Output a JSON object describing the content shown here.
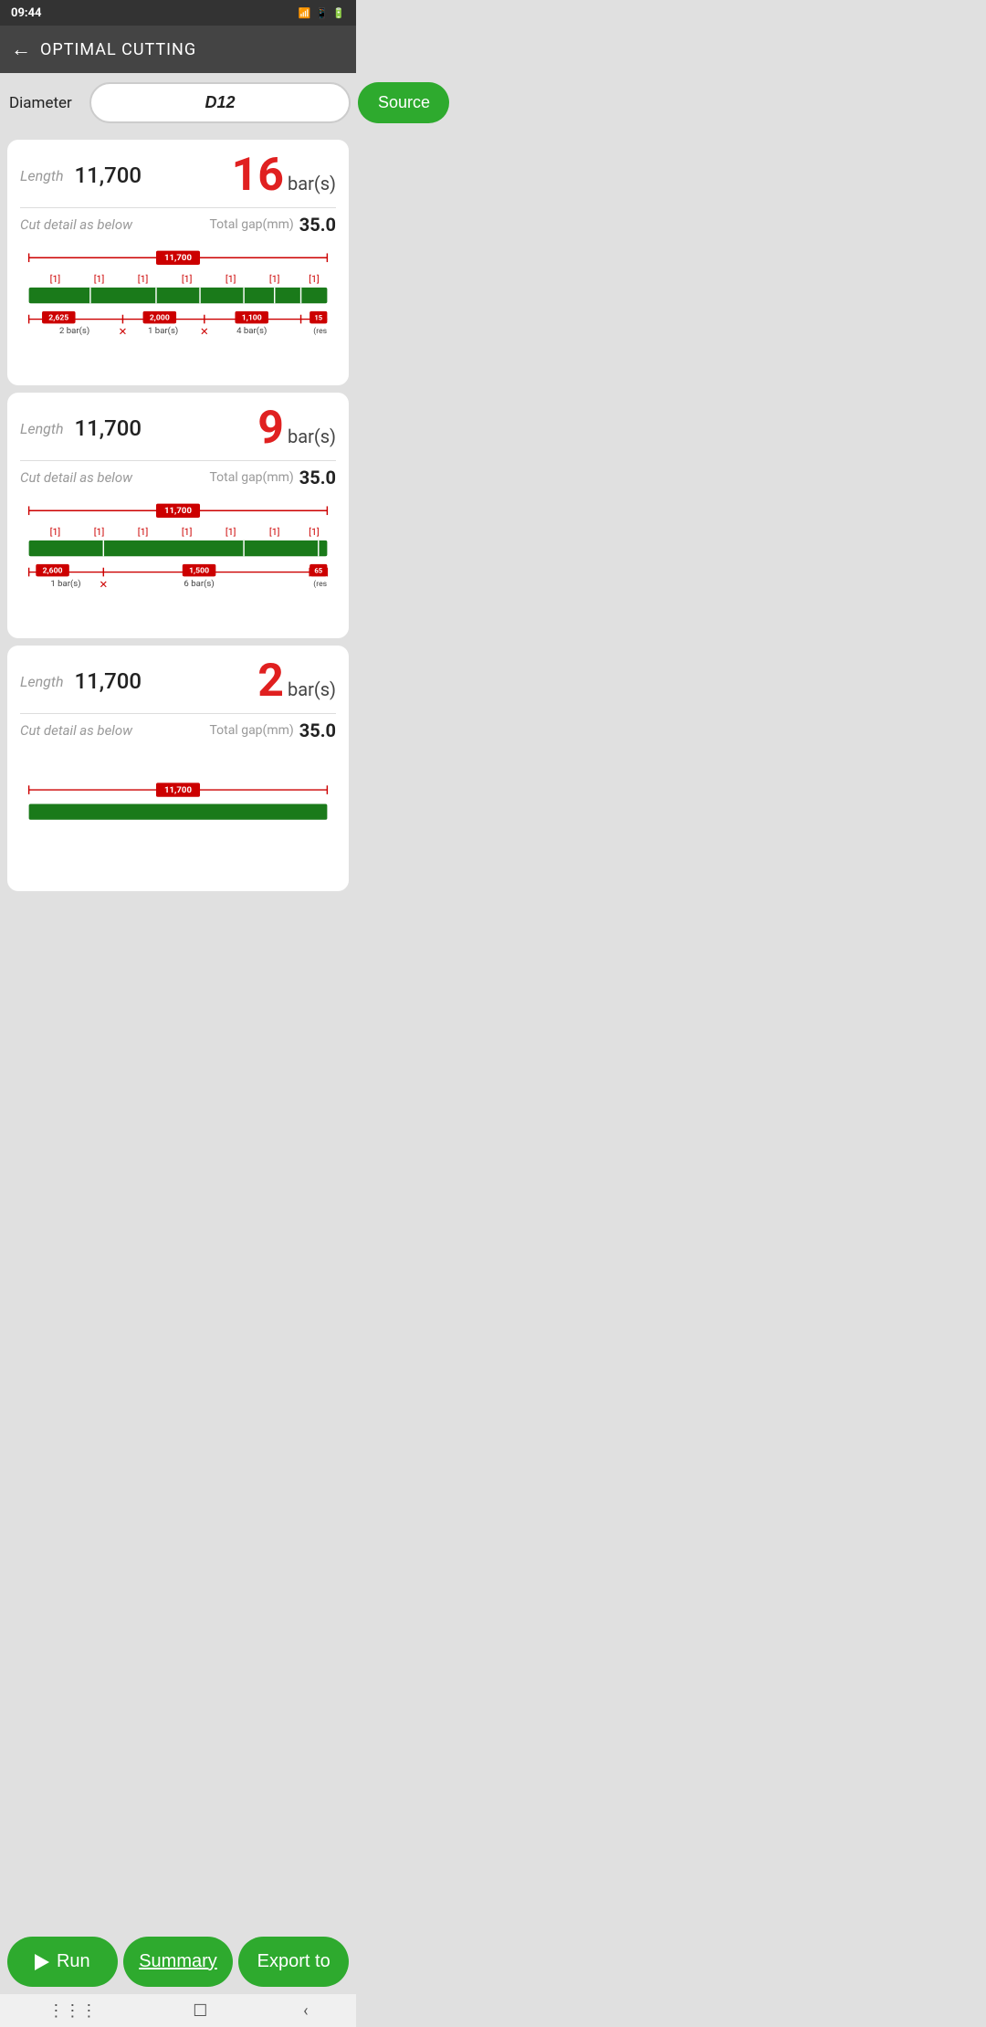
{
  "status": {
    "time": "09:44",
    "wifi": "WiFi",
    "signal": "Signal",
    "battery": "Battery"
  },
  "header": {
    "title": "OPTIMAL CUTTING",
    "back_label": "←"
  },
  "diameter": {
    "label": "Diameter",
    "value": "D12",
    "source_btn": "Source"
  },
  "results": [
    {
      "length_label": "Length",
      "length_value": "11,700",
      "bars_count": "16",
      "bars_unit": "bar(s)",
      "cut_detail_label": "Cut detail as below",
      "gap_label": "Total gap(mm)",
      "gap_value": "35.0",
      "diagram_total": "11,700",
      "segments": [
        {
          "label": "2,625",
          "count": "2 bar(s)"
        },
        {
          "label": "2,000",
          "count": "1 bar(s)"
        },
        {
          "label": "1,100",
          "count": "4 bar(s)"
        },
        {
          "label": "15",
          "count": "(res"
        }
      ],
      "bracket_labels": [
        "[1]",
        "[1]",
        "[1]",
        "[1]",
        "[1]",
        "[1]",
        "[1]"
      ]
    },
    {
      "length_label": "Length",
      "length_value": "11,700",
      "bars_count": "9",
      "bars_unit": "bar(s)",
      "cut_detail_label": "Cut detail as below",
      "gap_label": "Total gap(mm)",
      "gap_value": "35.0",
      "diagram_total": "11,700",
      "segments": [
        {
          "label": "2,600",
          "count": "1 bar(s)"
        },
        {
          "label": "1,500",
          "count": "6 bar(s)"
        },
        {
          "label": "65",
          "count": "(res"
        }
      ],
      "bracket_labels": [
        "[1]",
        "[1]",
        "[1]",
        "[1]",
        "[1]",
        "[1]",
        "[1]"
      ]
    },
    {
      "length_label": "Length",
      "length_value": "11,700",
      "bars_count": "2",
      "bars_unit": "bar(s)",
      "cut_detail_label": "Cut detail as below",
      "gap_label": "Total gap(mm)",
      "gap_value": "35.0",
      "diagram_total": "11,700",
      "segments": [],
      "bracket_labels": []
    }
  ],
  "bottom": {
    "run_label": "Run",
    "summary_label": "Summary",
    "export_label": "Export to"
  }
}
